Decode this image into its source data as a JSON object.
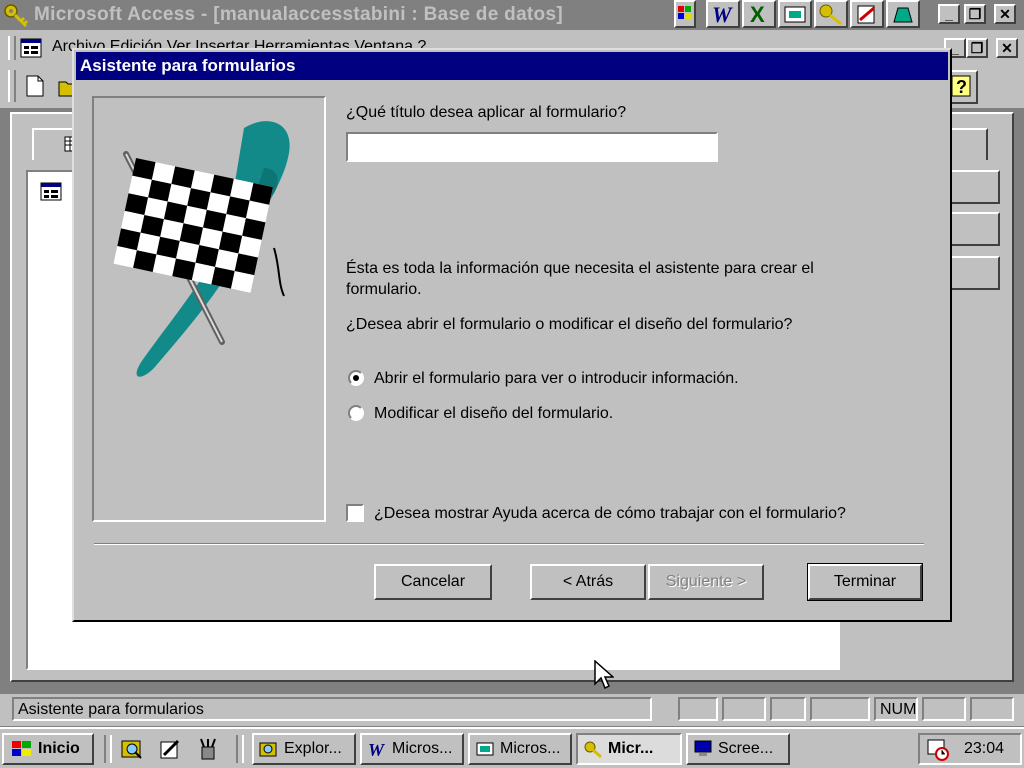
{
  "app": {
    "title": "Microsoft Access - [manualaccesstabini : Base de datos]",
    "menu_partial": "Archivo  Edición  Ver  Insertar  Herramientas  Ventana  ?"
  },
  "dialog": {
    "title": "Asistente para formularios",
    "question_title": "¿Qué título desea aplicar al formulario?",
    "title_value": "",
    "info_text": "Ésta es toda la información que necesita el asistente para crear el formulario.",
    "question_open": "¿Desea abrir el formulario o modificar el diseño del formulario?",
    "options": [
      {
        "label": "Abrir el formulario para ver o introducir información.",
        "selected": true
      },
      {
        "label": "Modificar el diseño del formulario.",
        "selected": false
      }
    ],
    "help_checkbox": {
      "label": "¿Desea mostrar Ayuda acerca de cómo trabajar con el formulario?",
      "checked": false
    },
    "buttons": {
      "cancel": "Cancelar",
      "back": "< Atrás",
      "next": "Siguiente >",
      "finish": "Terminar"
    }
  },
  "statusbar": {
    "text": "Asistente para formularios",
    "num": "NUM"
  },
  "taskbar": {
    "start": "Inicio",
    "tasks": [
      "Explor...",
      "Micros...",
      "Micros...",
      "Micr...",
      "Scree..."
    ],
    "clock": "23:04"
  },
  "colors": {
    "titlebar_active": "#000080",
    "face": "#c0c0c0",
    "teal_splash": "#138a8a"
  }
}
